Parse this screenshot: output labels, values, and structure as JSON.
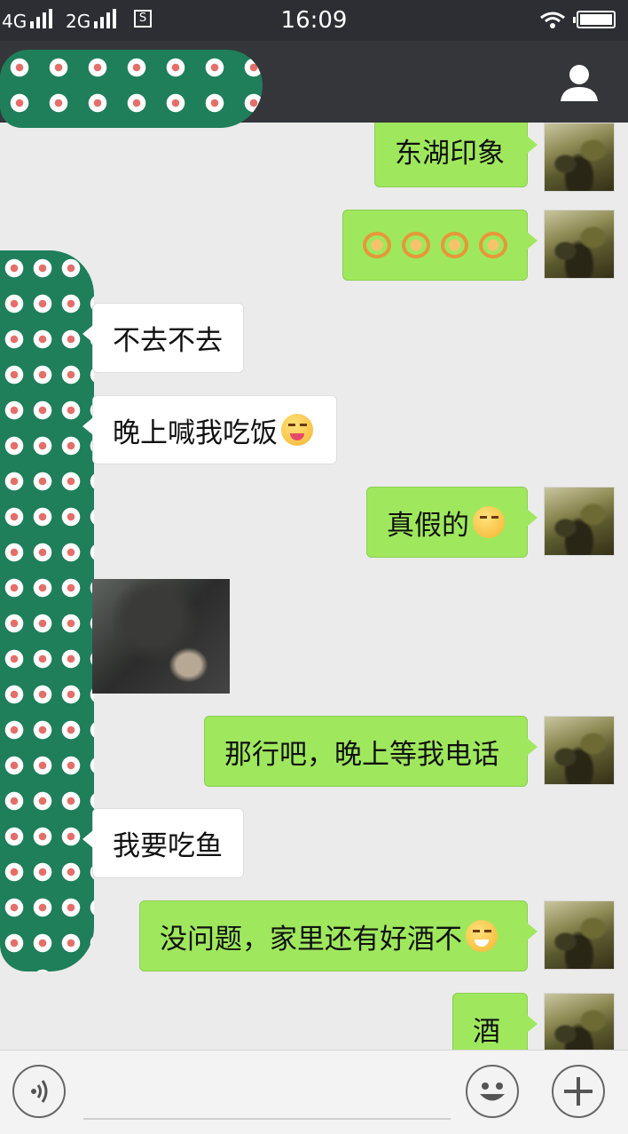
{
  "status_bar": {
    "network_1": "4G",
    "network_2": "2G",
    "sim_badge": "S",
    "time": "16:09",
    "icons": [
      "signal-icon",
      "wifi-icon",
      "battery-icon"
    ]
  },
  "header": {
    "contact_name_redacted": true,
    "profile_icon": "person-icon"
  },
  "messages": [
    {
      "side": "me",
      "text": "东湖印象"
    },
    {
      "side": "me",
      "type": "emoji",
      "emoji": "snail",
      "count": 4
    },
    {
      "side": "them",
      "text": "不去不去"
    },
    {
      "side": "them",
      "text": "晚上喊我吃饭",
      "emoji": "tongue-out"
    },
    {
      "side": "me",
      "text": "真假的",
      "emoji": "smirk"
    },
    {
      "side": "them",
      "type": "image"
    },
    {
      "side": "me",
      "text": "那行吧，晚上等我电话"
    },
    {
      "side": "them",
      "text": "我要吃鱼"
    },
    {
      "side": "me",
      "text": "没问题，家里还有好酒不",
      "emoji": "grin"
    },
    {
      "side": "me",
      "text": "酒"
    }
  ],
  "toolbar": {
    "icons": [
      "voice-icon",
      "emoji-icon",
      "plus-icon"
    ],
    "input_value": ""
  },
  "colors": {
    "sent_bubble": "#9fe85d",
    "received_bubble": "#ffffff",
    "header_bg": "#35363a",
    "chat_bg": "#ebebeb"
  }
}
